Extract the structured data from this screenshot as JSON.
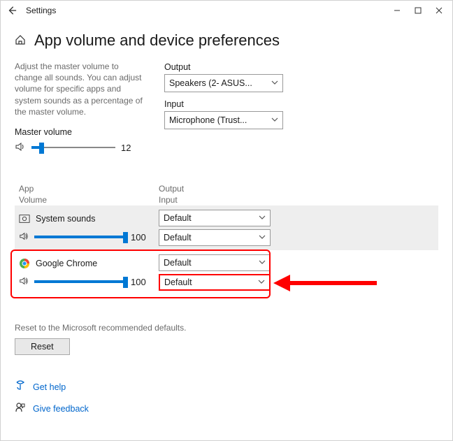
{
  "window": {
    "title": "Settings"
  },
  "page": {
    "heading": "App volume and device preferences",
    "description": "Adjust the master volume to change all sounds. You can adjust volume for specific apps and system sounds as a percentage of the master volume.",
    "master_volume_label": "Master volume",
    "master_volume_value": "12"
  },
  "output": {
    "label": "Output",
    "selected": "Speakers (2- ASUS..."
  },
  "input": {
    "label": "Input",
    "selected": "Microphone (Trust..."
  },
  "list_header": {
    "col_app_line1": "App",
    "col_app_line2": "Volume",
    "col_oi_line1": "Output",
    "col_oi_line2": "Input"
  },
  "apps": [
    {
      "name": "System sounds",
      "volume": "100",
      "output_selected": "Default",
      "input_selected": "Default"
    },
    {
      "name": "Google Chrome",
      "volume": "100",
      "output_selected": "Default",
      "input_selected": "Default"
    }
  ],
  "reset": {
    "hint": "Reset to the Microsoft recommended defaults.",
    "button": "Reset"
  },
  "help": {
    "get_help": "Get help",
    "give_feedback": "Give feedback"
  }
}
